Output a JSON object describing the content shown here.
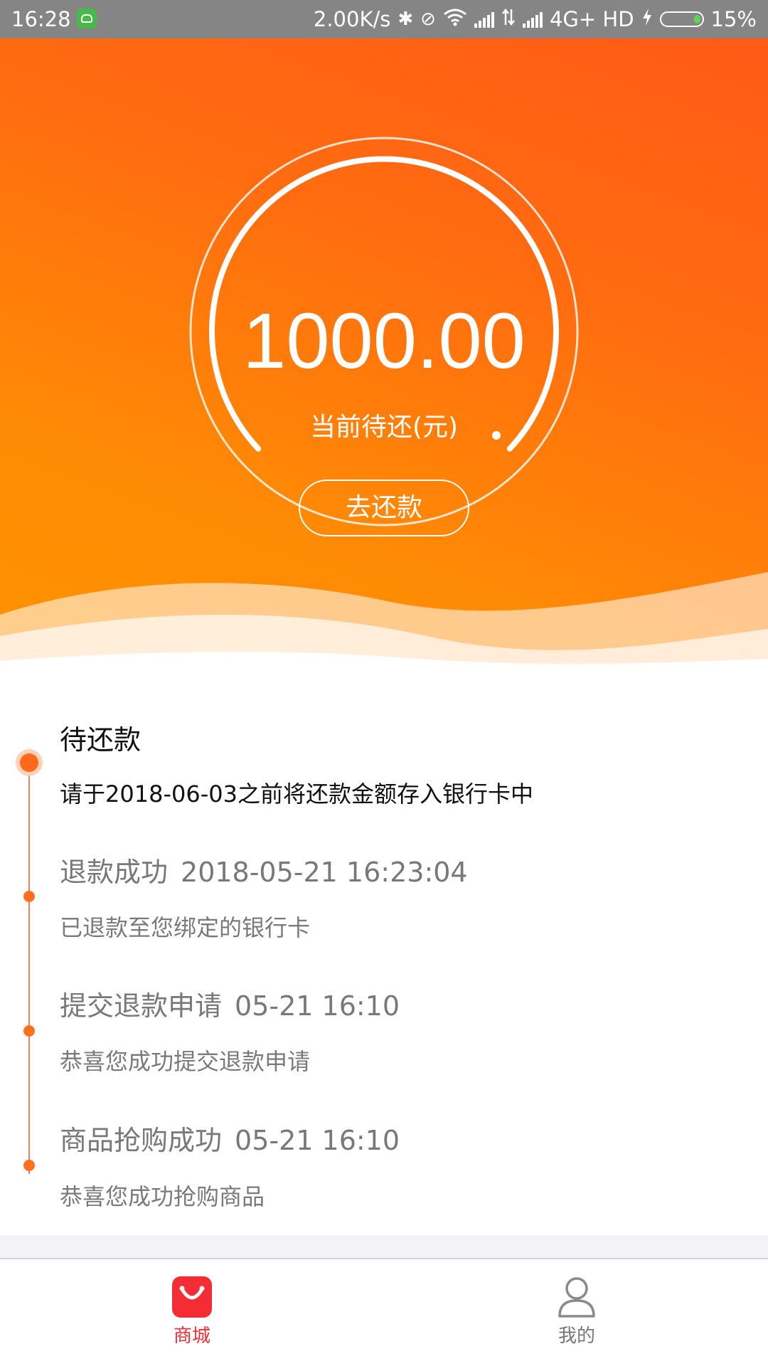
{
  "status_bar": {
    "time": "16:28",
    "network_speed": "2.00K/s",
    "network_type": "4G+ HD",
    "battery": "15%",
    "icons": [
      "app-notification-icon",
      "bluetooth-icon",
      "vibrate-icon",
      "wifi-icon",
      "signal-icon",
      "data-arrows-icon",
      "signal-icon",
      "charging-icon",
      "battery-icon"
    ]
  },
  "hero": {
    "amount": "1000.00",
    "amount_label": "当前待还(元)",
    "repay_button": "去还款",
    "colors": {
      "gradient_top": "#ff5a16",
      "gradient_bottom": "#ff9400"
    }
  },
  "timeline": {
    "accent_color": "#ff6f1e",
    "items": [
      {
        "title": "待还款",
        "time": "",
        "description": "请于2018-06-03之前将还款金额存入银行卡中",
        "active": true
      },
      {
        "title": "退款成功",
        "time": "2018-05-21 16:23:04",
        "description": "已退款至您绑定的银行卡",
        "active": false
      },
      {
        "title": "提交退款申请",
        "time": "05-21 16:10",
        "description": "恭喜您成功提交退款申请",
        "active": false
      },
      {
        "title": "商品抢购成功",
        "time": "05-21 16:10",
        "description": "恭喜您成功抢购商品",
        "active": false
      }
    ]
  },
  "tab_bar": {
    "tabs": [
      {
        "label": "商城",
        "icon": "shopping-bag-icon",
        "selected": true
      },
      {
        "label": "我的",
        "icon": "user-icon",
        "selected": false
      }
    ],
    "selected_color": "#f42d34"
  }
}
